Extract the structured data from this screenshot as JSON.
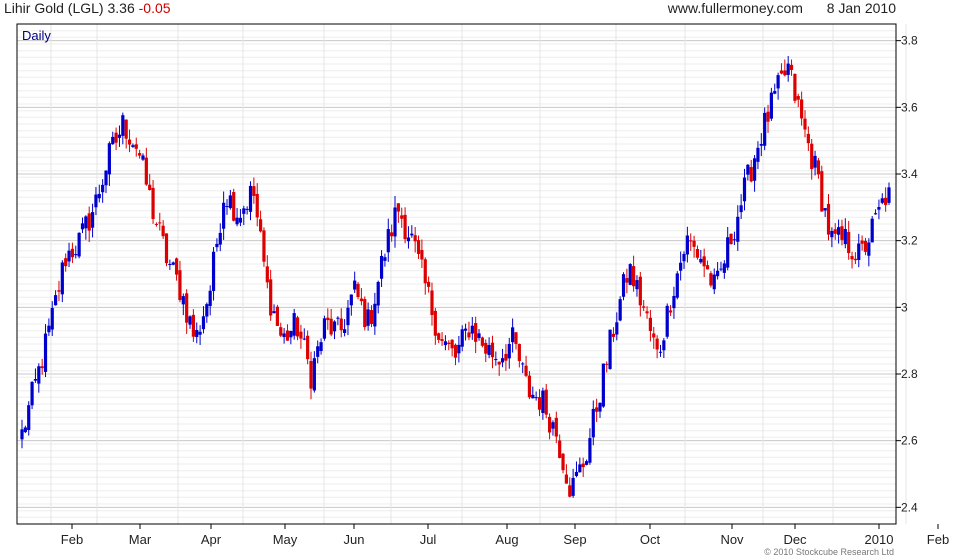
{
  "header": {
    "instrument": "Lihir Gold (LGL)",
    "last": "3.36",
    "change": "-0.05",
    "site": "www.fullermoney.com",
    "date": "8 Jan 2010"
  },
  "footer": {
    "copyright": "© 2010 Stockcube Research Ltd"
  },
  "chart_data": {
    "type": "candlestick",
    "frequency_label": "Daily",
    "y_axis_side": "right",
    "ylim": [
      2.35,
      3.85
    ],
    "y_ticks": [
      2.4,
      2.6,
      2.8,
      3,
      3.2,
      3.4,
      3.6,
      3.8
    ],
    "y_tick_labels": [
      "2.4",
      "2.6",
      "2.8",
      "3",
      "3.2",
      "3.4",
      "3.6",
      "3.8"
    ],
    "x_ticks": [
      "Feb",
      "Mar",
      "Apr",
      "May",
      "Jun",
      "Jul",
      "Aug",
      "Sep",
      "Oct",
      "Nov",
      "Dec",
      "2010",
      "Feb"
    ],
    "grid": true,
    "colors": {
      "up": "#0000cc",
      "down": "#dd0000",
      "grid": "#d4d4d4",
      "frame": "#000000",
      "label": "#000080"
    },
    "anchors": [
      [
        "Jan",
        2.62
      ],
      [
        "Jan",
        2.78
      ],
      [
        "Jan",
        2.95
      ],
      [
        "Jan",
        3.15
      ],
      [
        "Feb",
        3.2
      ],
      [
        "Feb",
        3.3
      ],
      [
        "Feb",
        3.45
      ],
      [
        "Feb",
        3.55
      ],
      [
        "Feb",
        3.48
      ],
      [
        "Mar",
        3.3
      ],
      [
        "Mar",
        3.15
      ],
      [
        "Mar",
        3.05
      ],
      [
        "Mar",
        2.9
      ],
      [
        "Mar",
        3.05
      ],
      [
        "Mar",
        3.35
      ],
      [
        "Mar",
        3.28
      ],
      [
        "Apr",
        3.35
      ],
      [
        "Apr",
        3.05
      ],
      [
        "Apr",
        2.9
      ],
      [
        "Apr",
        2.95
      ],
      [
        "Apr",
        2.8
      ],
      [
        "May",
        2.95
      ],
      [
        "May",
        2.92
      ],
      [
        "May",
        3.05
      ],
      [
        "May",
        2.95
      ],
      [
        "May",
        3.15
      ],
      [
        "Jun",
        3.3
      ],
      [
        "Jun",
        3.2
      ],
      [
        "Jun",
        3.05
      ],
      [
        "Jun",
        2.9
      ],
      [
        "Jul",
        2.85
      ],
      [
        "Jul",
        2.95
      ],
      [
        "Jul",
        2.88
      ],
      [
        "Jul",
        2.85
      ],
      [
        "Jul",
        2.9
      ],
      [
        "Aug",
        2.75
      ],
      [
        "Aug",
        2.72
      ],
      [
        "Aug",
        2.62
      ],
      [
        "Aug",
        2.45
      ],
      [
        "Aug",
        2.55
      ],
      [
        "Sep",
        2.75
      ],
      [
        "Sep",
        2.95
      ],
      [
        "Sep",
        3.12
      ],
      [
        "Sep",
        3.0
      ],
      [
        "Oct",
        2.85
      ],
      [
        "Oct",
        3.05
      ],
      [
        "Oct",
        3.2
      ],
      [
        "Oct",
        3.15
      ],
      [
        "Oct",
        3.05
      ],
      [
        "Nov",
        3.2
      ],
      [
        "Nov",
        3.35
      ],
      [
        "Nov",
        3.5
      ],
      [
        "Nov",
        3.62
      ],
      [
        "Dec",
        3.72
      ],
      [
        "Dec",
        3.55
      ],
      [
        "Dec",
        3.4
      ],
      [
        "Dec",
        3.2
      ],
      [
        "Dec",
        3.2
      ],
      [
        "Dec",
        3.15
      ],
      [
        "2010",
        3.25
      ],
      [
        "2010",
        3.36
      ]
    ]
  }
}
